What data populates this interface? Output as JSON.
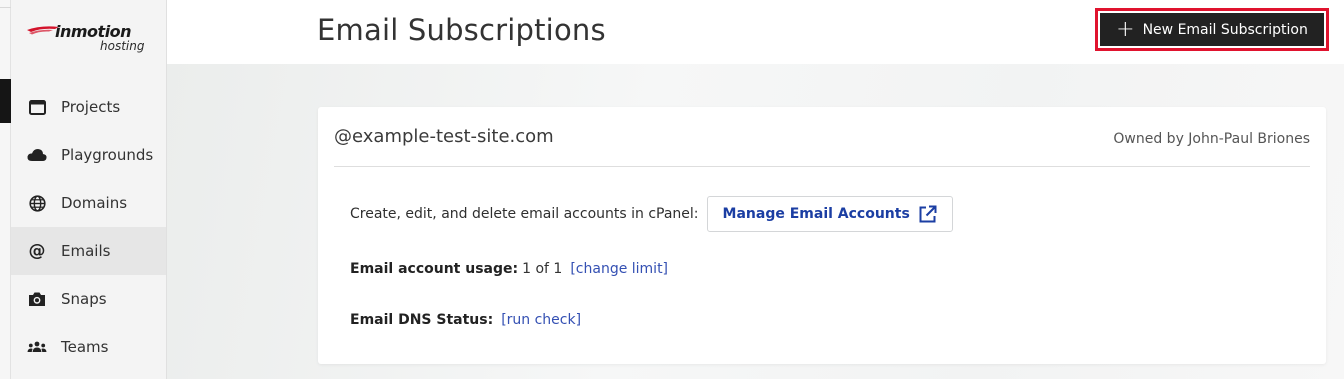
{
  "logo": {
    "brand": "inmotion",
    "sub": "hosting"
  },
  "sidebar": {
    "items": [
      {
        "label": "Projects",
        "icon": "window-icon"
      },
      {
        "label": "Playgrounds",
        "icon": "cloud-icon"
      },
      {
        "label": "Domains",
        "icon": "globe-icon"
      },
      {
        "label": "Emails",
        "icon": "at-icon",
        "active": true
      },
      {
        "label": "Snaps",
        "icon": "camera-icon"
      },
      {
        "label": "Teams",
        "icon": "people-icon"
      }
    ]
  },
  "header": {
    "title": "Email Subscriptions",
    "new_button_label": "New Email Subscription"
  },
  "card": {
    "domain": "@example-test-site.com",
    "owner": "Owned by John-Paul Briones",
    "cpanel_text": "Create, edit, and delete email accounts in cPanel:",
    "manage_button": "Manage Email Accounts",
    "usage_label": "Email account usage:",
    "usage_value": "1 of 1",
    "change_limit": "[change limit]",
    "dns_label": "Email DNS Status:",
    "run_check": "[run check]"
  },
  "colors": {
    "accent_red": "#e0132e",
    "link_blue": "#3450b3",
    "dark_button": "#222222"
  }
}
